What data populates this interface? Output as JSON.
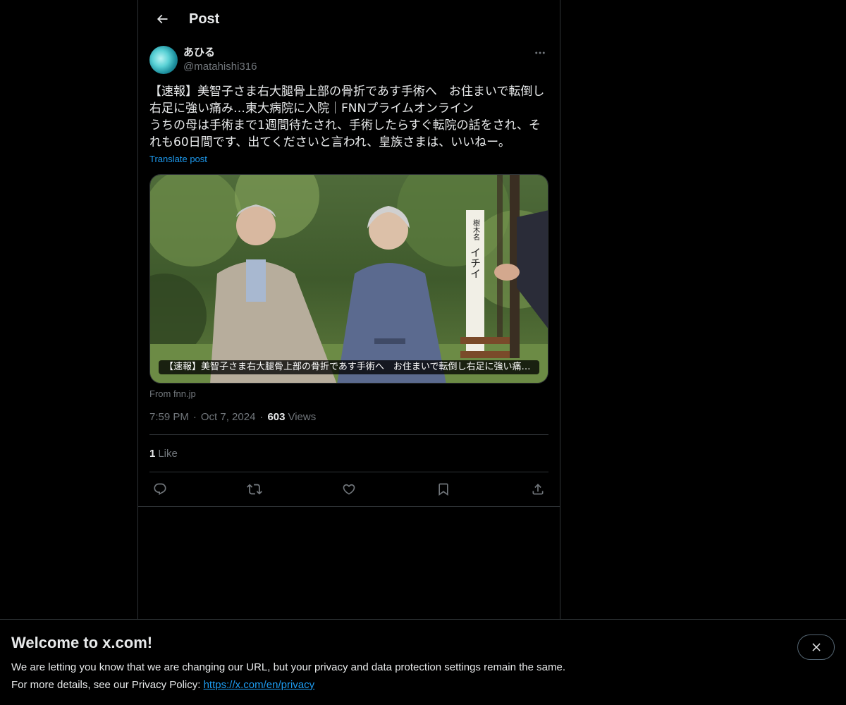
{
  "header": {
    "title": "Post"
  },
  "post": {
    "author": {
      "display_name": "あひる",
      "handle": "@matahishi316"
    },
    "text": "【速報】美智子さま右大腿骨上部の骨折であす手術へ　お住まいで転倒し右足に強い痛み…東大病院に入院｜FNNプライムオンライン\nうちの母は手術まで1週間待たされ、手術したらすぐ転院の話をされ、それも60日間です、出てくださいと言われ、皇族さまは、いいねー。",
    "translate_label": "Translate post",
    "card": {
      "caption": "【速報】美智子さま右大腿骨上部の骨折であす手術へ　お住まいで転倒し右足に強い痛み…",
      "sign_text": "樹木名 イチイ",
      "source": "From fnn.jp"
    },
    "time": "7:59 PM",
    "date": "Oct 7, 2024",
    "separator": "·",
    "views_count": "603",
    "views_label": "Views",
    "likes_count": "1",
    "likes_label": "Like"
  },
  "banner": {
    "title": "Welcome to x.com!",
    "line1": "We are letting you know that we are changing our URL, but your privacy and data protection settings remain the same.",
    "line2_prefix": "For more details, see our Privacy Policy: ",
    "link_text": "https://x.com/en/privacy"
  },
  "icons": {
    "back": "arrow-left-icon",
    "more": "more-horizontal-icon",
    "reply": "reply-icon",
    "repost": "repost-icon",
    "like": "heart-icon",
    "bookmark": "bookmark-icon",
    "share": "share-icon",
    "close": "close-icon"
  },
  "colors": {
    "accent": "#1d9bf0",
    "muted": "#71767b",
    "text": "#e7e9ea",
    "border": "#2f3336"
  }
}
